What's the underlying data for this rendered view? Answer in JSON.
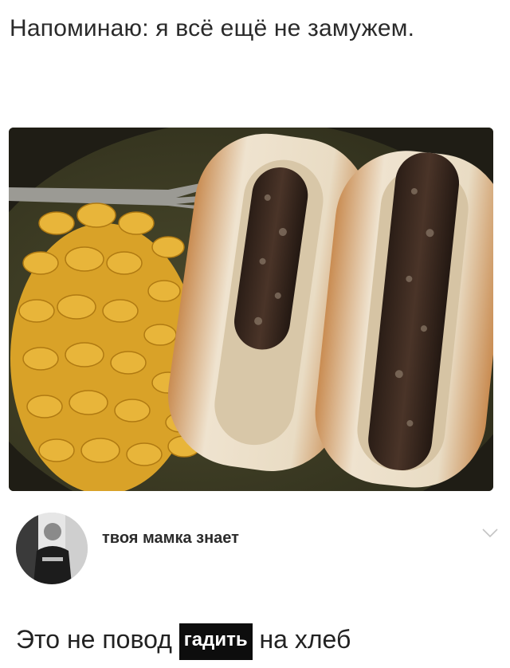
{
  "post": {
    "text": "Напоминаю: я всё ещё не замужем."
  },
  "photo": {
    "icon": "food-photo"
  },
  "comment": {
    "username": "твоя мамка знает",
    "caption_before": "Это не повод ",
    "caption_highlight": "гадить",
    "caption_after": " на хлеб"
  },
  "colors": {
    "highlight_bg": "#0d0d0d",
    "highlight_text": "#ffffff"
  }
}
